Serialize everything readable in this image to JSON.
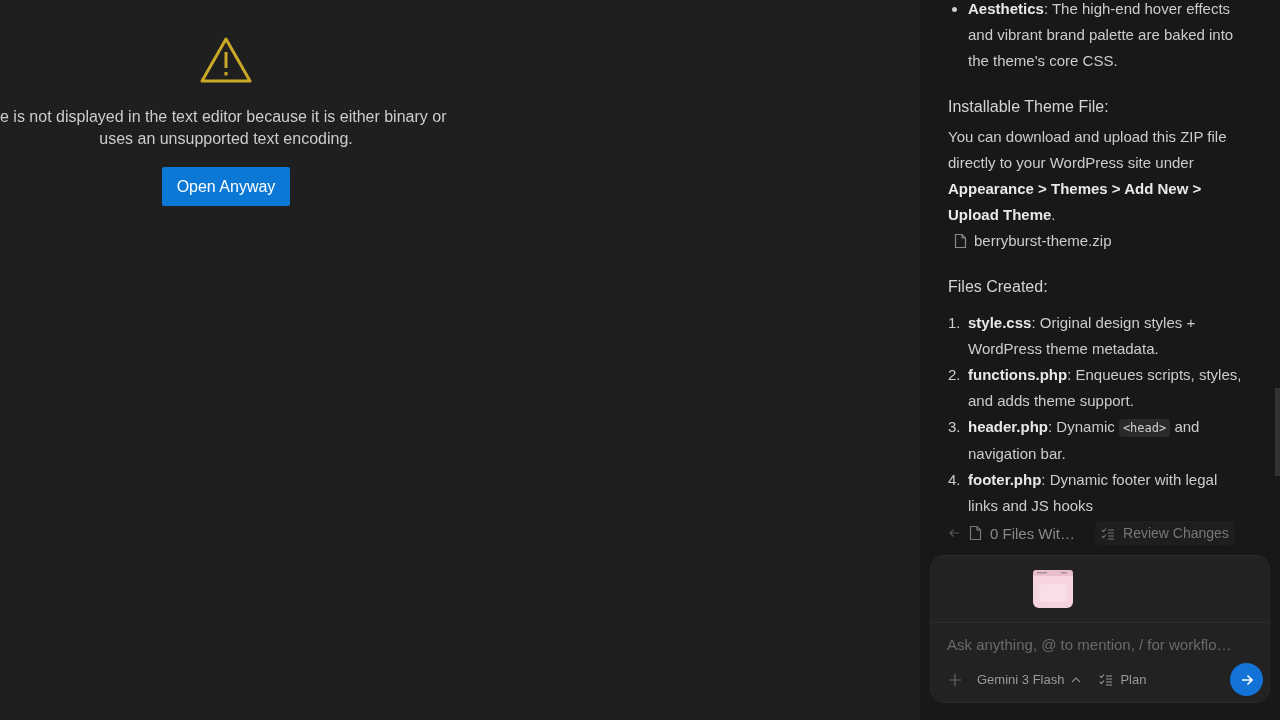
{
  "editor": {
    "message_lines": [
      "e is not displayed in the text editor because it is either binary or",
      "uses an unsupported text encoding."
    ],
    "button": "Open Anyway"
  },
  "chat": {
    "blocks": [
      {
        "kind": "bullets",
        "items": [
          [
            {
              "kind": "bold",
              "text": "Aesthetics"
            },
            {
              "kind": "text",
              "text": ": The high-end hover effects and vibrant brand palette are baked into the theme's core CSS."
            }
          ]
        ]
      },
      {
        "kind": "heading",
        "text": "Installable Theme File:"
      },
      {
        "kind": "paragraph",
        "parts": [
          {
            "kind": "text",
            "text": "You can download and upload this ZIP file directly to your WordPress site under "
          },
          {
            "kind": "bold",
            "text": "Appearance > Themes > Add New > Upload Theme"
          },
          {
            "kind": "text",
            "text": "."
          }
        ]
      },
      {
        "kind": "file",
        "text": "berryburst-theme.zip"
      },
      {
        "kind": "heading",
        "text": "Files Created:"
      },
      {
        "kind": "ordered",
        "items": [
          {
            "number": "1.",
            "parts": [
              {
                "kind": "bold",
                "text": "style.css"
              },
              {
                "kind": "text",
                "text": ": Original design styles + WordPress theme metadata."
              }
            ]
          },
          {
            "number": "2.",
            "parts": [
              {
                "kind": "bold",
                "text": "functions.php"
              },
              {
                "kind": "text",
                "text": ": Enqueues scripts, styles, and adds theme support."
              }
            ]
          },
          {
            "number": "3.",
            "parts": [
              {
                "kind": "bold",
                "text": "header.php"
              },
              {
                "kind": "text",
                "text": ": Dynamic "
              },
              {
                "kind": "code",
                "text": "<head>"
              },
              {
                "kind": "text",
                "text": " and navigation bar."
              }
            ]
          },
          {
            "number": "4.",
            "parts": [
              {
                "kind": "bold",
                "text": "footer.php"
              },
              {
                "kind": "text",
                "text": ": Dynamic footer with legal links and JS hooks"
              }
            ]
          }
        ]
      }
    ],
    "changes_bar": {
      "files": "0 Files Wit…",
      "review": "Review Changes"
    },
    "composer": {
      "placeholder": "Ask anything, @ to mention, / for workflo…",
      "model": "Gemini 3 Flash",
      "mode": "Plan"
    }
  }
}
